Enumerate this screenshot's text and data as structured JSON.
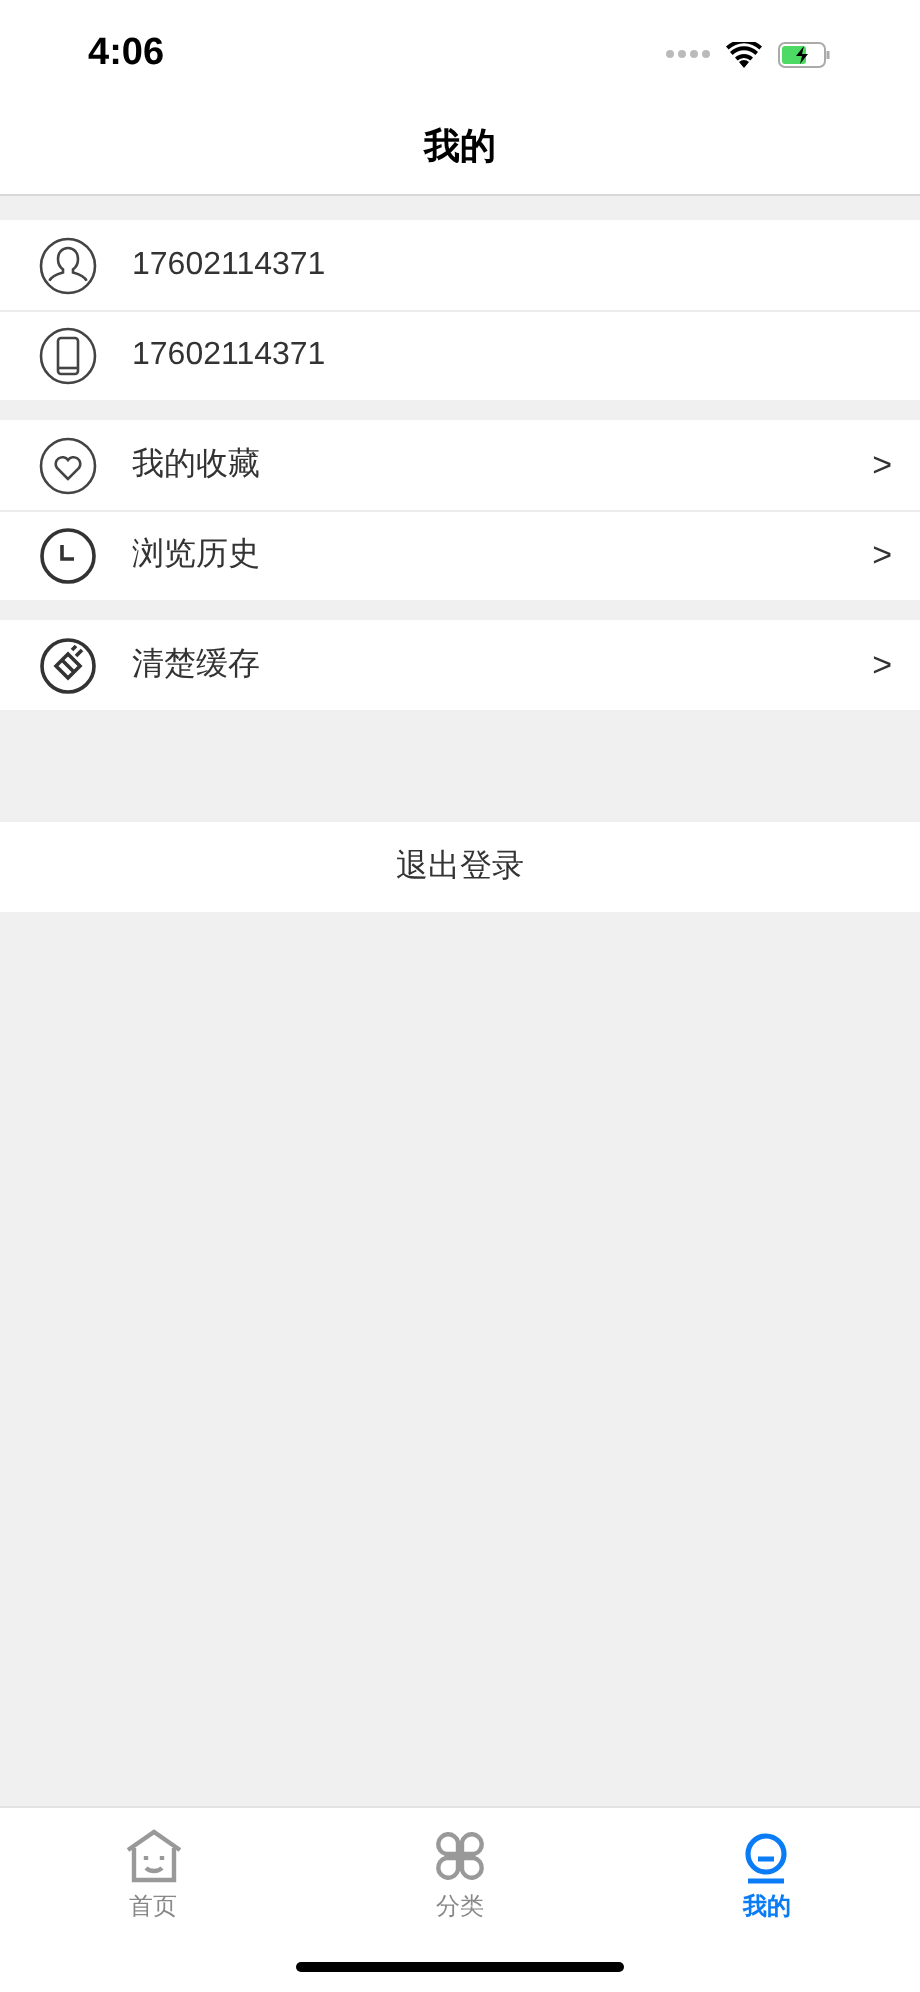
{
  "status_bar": {
    "time": "4:06"
  },
  "nav": {
    "title": "我的"
  },
  "groups": [
    [
      {
        "kind": "info",
        "label": "17602114371"
      },
      {
        "kind": "info",
        "label": "17602114371"
      }
    ],
    [
      {
        "kind": "link",
        "label": "我的收藏",
        "chevron": ">"
      },
      {
        "kind": "link",
        "label": "浏览历史",
        "chevron": ">"
      }
    ],
    [
      {
        "kind": "link",
        "label": "清楚缓存",
        "chevron": ">"
      }
    ]
  ],
  "logout": "退出登录",
  "tabs": [
    {
      "label": "首页",
      "selected": false
    },
    {
      "label": "分类",
      "selected": false
    },
    {
      "label": "我的",
      "selected": true
    }
  ]
}
